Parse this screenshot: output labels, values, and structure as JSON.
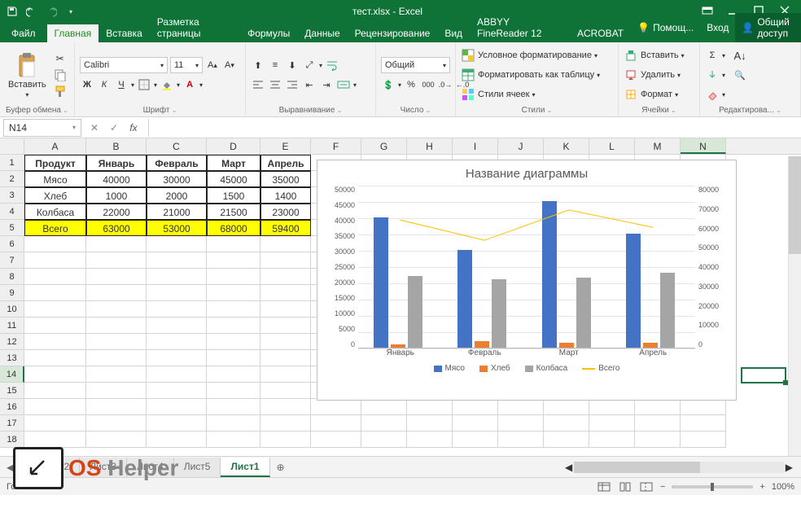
{
  "title": "тест.xlsx - Excel",
  "qat": {
    "save": "",
    "undo": "",
    "redo": ""
  },
  "tabs": [
    "Файл",
    "Главная",
    "Вставка",
    "Разметка страницы",
    "Формулы",
    "Данные",
    "Рецензирование",
    "Вид",
    "ABBYY FineReader 12",
    "ACROBAT"
  ],
  "tabs_right": {
    "help": "Помощ...",
    "signin": "Вход",
    "share": "Общий доступ"
  },
  "ribbon": {
    "clipboard": {
      "paste": "Вставить",
      "label": "Буфер обмена"
    },
    "font": {
      "name": "Calibri",
      "size": "11",
      "label": "Шрифт",
      "bold": "Ж",
      "italic": "К",
      "underline": "Ч"
    },
    "alignment": {
      "label": "Выравнивание"
    },
    "number": {
      "format": "Общий",
      "label": "Число"
    },
    "styles": {
      "cond": "Условное форматирование",
      "table": "Форматировать как таблицу",
      "cellstyles": "Стили ячеек",
      "label": "Стили"
    },
    "cells": {
      "insert": "Вставить",
      "delete": "Удалить",
      "format": "Формат",
      "label": "Ячейки"
    },
    "editing": {
      "label": "Редактирова..."
    }
  },
  "name_box": "N14",
  "columns": [
    "A",
    "B",
    "C",
    "D",
    "E",
    "F",
    "G",
    "H",
    "I",
    "J",
    "K",
    "L",
    "M",
    "N"
  ],
  "rowcount": 18,
  "table": {
    "header": [
      "Продукт",
      "Январь",
      "Февраль",
      "Март",
      "Апрель"
    ],
    "rows": [
      [
        "Мясо",
        "40000",
        "30000",
        "45000",
        "35000"
      ],
      [
        "Хлеб",
        "1000",
        "2000",
        "1500",
        "1400"
      ],
      [
        "Колбаса",
        "22000",
        "21000",
        "21500",
        "23000"
      ]
    ],
    "total": [
      "Всего",
      "63000",
      "53000",
      "68000",
      "59400"
    ]
  },
  "chart_data": {
    "type": "bar",
    "title": "Название диаграммы",
    "categories": [
      "Январь",
      "Февраль",
      "Март",
      "Апрель"
    ],
    "series": [
      {
        "name": "Мясо",
        "values": [
          40000,
          30000,
          45000,
          35000
        ],
        "axis": "left"
      },
      {
        "name": "Хлеб",
        "values": [
          1000,
          2000,
          1500,
          1400
        ],
        "axis": "left"
      },
      {
        "name": "Колбаса",
        "values": [
          22000,
          21000,
          21500,
          23000
        ],
        "axis": "left"
      },
      {
        "name": "Всего",
        "values": [
          63000,
          53000,
          68000,
          59400
        ],
        "axis": "right",
        "type": "line"
      }
    ],
    "ylim_left": [
      0,
      50000
    ],
    "yticks_left": [
      0,
      5000,
      10000,
      15000,
      20000,
      25000,
      30000,
      35000,
      40000,
      45000,
      50000
    ],
    "ylim_right": [
      0,
      80000
    ],
    "yticks_right": [
      0,
      10000,
      20000,
      30000,
      40000,
      50000,
      60000,
      70000,
      80000
    ]
  },
  "sheets": [
    "Лист2",
    "Лист3",
    "Лист4",
    "Лист5",
    "Лист1"
  ],
  "active_sheet": "Лист1",
  "status": "Готово",
  "zoom": "100%",
  "watermark": {
    "os": "OS",
    "helper": "Helper"
  }
}
